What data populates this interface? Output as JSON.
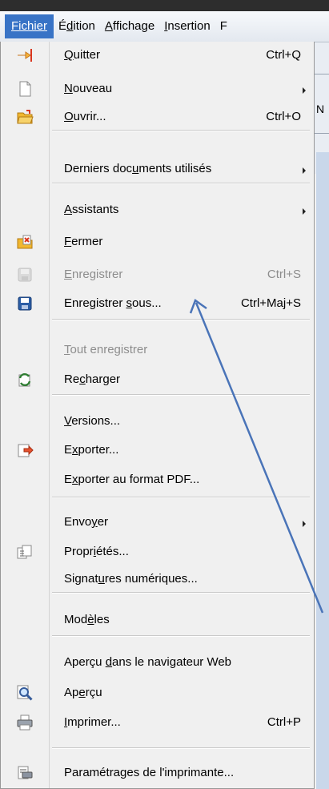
{
  "menubar": {
    "items": [
      {
        "label": "Fichier"
      },
      {
        "label": "Édition"
      },
      {
        "label": "Affichage"
      },
      {
        "label": "Insertion"
      },
      {
        "label": "F"
      }
    ]
  },
  "background": {
    "partial_text": "N"
  },
  "menu": {
    "items": [
      {
        "pre": "",
        "u": "N",
        "post": "ouveau",
        "accel": "",
        "submenu": true,
        "icon": "new-document-icon",
        "disabled": false
      },
      {
        "pre": "",
        "u": "O",
        "post": "uvrir...",
        "accel": "Ctrl+O",
        "submenu": false,
        "icon": "open-folder-icon",
        "disabled": false
      },
      {
        "pre": "Derniers doc",
        "u": "u",
        "post": "ments utilisés",
        "accel": "",
        "submenu": true,
        "icon": "",
        "disabled": false
      },
      {
        "pre": "",
        "u": "A",
        "post": "ssistants",
        "accel": "",
        "submenu": true,
        "icon": "",
        "disabled": false
      },
      {
        "pre": "",
        "u": "F",
        "post": "ermer",
        "accel": "",
        "submenu": false,
        "icon": "close-document-icon",
        "disabled": false
      },
      {
        "pre": "",
        "u": "E",
        "post": "nregistrer",
        "accel": "Ctrl+S",
        "submenu": false,
        "icon": "save-icon",
        "disabled": true
      },
      {
        "pre": "Enregistrer ",
        "u": "s",
        "post": "ous...",
        "accel": "Ctrl+Maj+S",
        "submenu": false,
        "icon": "save-as-icon",
        "disabled": false
      },
      {
        "pre": "",
        "u": "T",
        "post": "out enregistrer",
        "accel": "",
        "submenu": false,
        "icon": "",
        "disabled": true
      },
      {
        "pre": "Re",
        "u": "c",
        "post": "harger",
        "accel": "",
        "submenu": false,
        "icon": "reload-icon",
        "disabled": false
      },
      {
        "pre": "",
        "u": "V",
        "post": "ersions...",
        "accel": "",
        "submenu": false,
        "icon": "",
        "disabled": false
      },
      {
        "pre": "E",
        "u": "x",
        "post": "porter...",
        "accel": "",
        "submenu": false,
        "icon": "export-icon",
        "disabled": false
      },
      {
        "pre": "E",
        "u": "x",
        "post": "porter au format PDF...",
        "accel": "",
        "submenu": false,
        "icon": "",
        "disabled": false
      },
      {
        "pre": "Envo",
        "u": "y",
        "post": "er",
        "accel": "",
        "submenu": true,
        "icon": "",
        "disabled": false
      },
      {
        "pre": "Propr",
        "u": "i",
        "post": "étés...",
        "accel": "",
        "submenu": false,
        "icon": "properties-icon",
        "disabled": false
      },
      {
        "pre": "Signat",
        "u": "u",
        "post": "res numériques...",
        "accel": "",
        "submenu": false,
        "icon": "",
        "disabled": false
      },
      {
        "pre": "Mod",
        "u": "è",
        "post": "les",
        "accel": "",
        "submenu": false,
        "icon": "",
        "disabled": false
      },
      {
        "pre": "Aperçu ",
        "u": "d",
        "post": "ans le navigateur Web",
        "accel": "",
        "submenu": false,
        "icon": "",
        "disabled": false
      },
      {
        "pre": "Ap",
        "u": "e",
        "post": "rçu",
        "accel": "",
        "submenu": false,
        "icon": "preview-icon",
        "disabled": false
      },
      {
        "pre": "",
        "u": "I",
        "post": "mprimer...",
        "accel": "Ctrl+P",
        "submenu": false,
        "icon": "printer-icon",
        "disabled": false
      },
      {
        "pre": "Paramétra",
        "u": "g",
        "post": "es de l'imprimante...",
        "accel": "",
        "submenu": false,
        "icon": "printer-settings-icon",
        "disabled": false
      },
      {
        "pre": "",
        "u": "Q",
        "post": "uitter",
        "accel": "Ctrl+Q",
        "submenu": false,
        "icon": "exit-icon",
        "disabled": false
      }
    ]
  },
  "colors": {
    "menubar_active": "#3873c6",
    "annotation_arrow": "#4a74b8"
  }
}
